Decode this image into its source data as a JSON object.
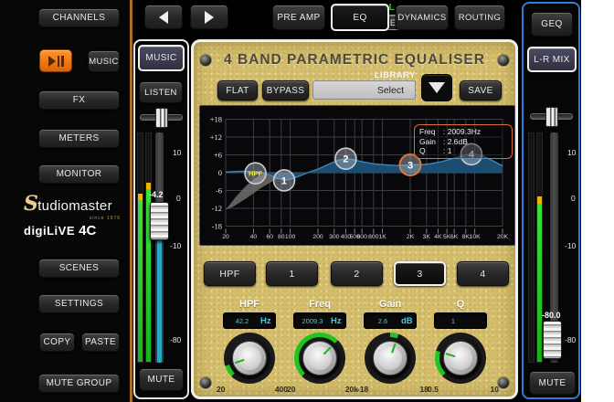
{
  "colors": {
    "accent_orange": "#f07818",
    "sidebar_border_orange": "#b56a1e",
    "master_border_blue": "#2b7fd6",
    "panel_gold": "#d4be6e",
    "display_cyan": "#3fd0e0",
    "knob_green": "#22c422",
    "meter_green": "#1fcc1f",
    "meter_yellow": "#f0b400",
    "curve_fill": "#1c5176",
    "curve_stroke": "#3f88b8",
    "selected_ring_orange": "#e07838",
    "mode_green": "#35d435",
    "fader_lower_cyan": "#2aa8c8"
  },
  "sidebar": {
    "buttons": [
      {
        "label": "CHANNELS"
      },
      {
        "label": "FX"
      },
      {
        "label": "METERS"
      },
      {
        "label": "MONITOR"
      },
      {
        "label": "SCENES"
      },
      {
        "label": "SETTINGS"
      },
      {
        "label": "MUTE GROUP"
      }
    ],
    "play_music_label": "MUSIC",
    "copy_label": "COPY",
    "paste_label": "PASTE",
    "logo": {
      "brand_initial": "S",
      "brand_rest": "tudiomaster",
      "tagline": "since 1976",
      "model": "digiLiVE",
      "model_suffix": "4C"
    }
  },
  "topbar": {
    "mode_status": "FULL",
    "mode_label": "MODE",
    "tabs": [
      {
        "label": "PRE AMP",
        "selected": false
      },
      {
        "label": "EQ",
        "selected": true
      },
      {
        "label": "DYNAMICS",
        "selected": false
      },
      {
        "label": "ROUTING",
        "selected": false
      }
    ]
  },
  "channel_strip": {
    "name": "MUSIC",
    "listen_label": "LISTEN",
    "fader_value": "-4.2",
    "scale": [
      "10",
      "0",
      "-10",
      "-80"
    ],
    "mute_label": "MUTE"
  },
  "master_strip": {
    "geq_label": "GEQ",
    "name": "L-R MIX",
    "fader_value": "-80.0",
    "scale": [
      "10",
      "0",
      "-10",
      "-80"
    ],
    "mute_label": "MUTE"
  },
  "eq_panel": {
    "title": "4 BAND PARAMETRIC EQUALISER",
    "flat_label": "FLAT",
    "bypass_label": "BYPASS",
    "library_label": "LIBRARY",
    "library_value": "Select",
    "save_label": "SAVE",
    "info": [
      {
        "label": "Freq",
        "value": ": 2009.3Hz"
      },
      {
        "label": "Gain",
        "value": ": 2.6dB"
      },
      {
        "label": "Q",
        "value": ": 1"
      }
    ],
    "band_buttons": [
      {
        "label": "HPF",
        "selected": false
      },
      {
        "label": "1",
        "selected": false
      },
      {
        "label": "2",
        "selected": false
      },
      {
        "label": "3",
        "selected": true
      },
      {
        "label": "4",
        "selected": false
      }
    ],
    "knobs": [
      {
        "label": "HPF",
        "value": "42.2",
        "unit": "Hz",
        "min_label": "20",
        "max_label": "400",
        "fraction": 0.1,
        "bipolar": false
      },
      {
        "label": "Freq",
        "value": "2009.3",
        "unit": "Hz",
        "min_label": "20",
        "max_label": "20k",
        "fraction": 0.667,
        "bipolar": false
      },
      {
        "label": "Gain",
        "value": "2.6",
        "unit": "dB",
        "min_label": "-18",
        "max_label": "18",
        "fraction": 0.572,
        "bipolar": true
      },
      {
        "label": "Q",
        "value": "1",
        "unit": "",
        "min_label": "0.5",
        "max_label": "10",
        "fraction": 0.23,
        "bipolar": false
      }
    ]
  },
  "chart_data": {
    "type": "line",
    "title": "4 BAND PARAMETRIC EQUALISER",
    "x_scale": "log",
    "xlim": [
      20,
      20000
    ],
    "ylim": [
      -21,
      21
    ],
    "y_unit": "dB",
    "x_unit": "Hz",
    "grid": true,
    "x_ticks": [
      {
        "f": 20,
        "label": "20"
      },
      {
        "f": 40,
        "label": "40"
      },
      {
        "f": 60,
        "label": "60"
      },
      {
        "f": 80,
        "label": "80"
      },
      {
        "f": 100,
        "label": "100"
      },
      {
        "f": 200,
        "label": "200"
      },
      {
        "f": 300,
        "label": "300"
      },
      {
        "f": 400,
        "label": "400"
      },
      {
        "f": 500,
        "label": "500"
      },
      {
        "f": 600,
        "label": "600"
      },
      {
        "f": 800,
        "label": "800"
      },
      {
        "f": 1000,
        "label": "1K"
      },
      {
        "f": 2000,
        "label": "2K"
      },
      {
        "f": 3000,
        "label": "3K"
      },
      {
        "f": 4000,
        "label": "4K"
      },
      {
        "f": 5000,
        "label": "5K"
      },
      {
        "f": 6000,
        "label": "6K"
      },
      {
        "f": 8000,
        "label": "8K"
      },
      {
        "f": 10000,
        "label": "10K"
      },
      {
        "f": 20000,
        "label": "20K"
      }
    ],
    "y_ticks": [
      {
        "v": 18,
        "label": "+18"
      },
      {
        "v": 12,
        "label": "+12"
      },
      {
        "v": 6,
        "label": "+6"
      },
      {
        "v": 0,
        "label": "0"
      },
      {
        "v": -6,
        "label": "-6"
      },
      {
        "v": -12,
        "label": "-12"
      },
      {
        "v": -18,
        "label": "-18"
      }
    ],
    "response_curve": [
      [
        20,
        0.2
      ],
      [
        30,
        0.5
      ],
      [
        45,
        0.2
      ],
      [
        60,
        -0.8
      ],
      [
        75,
        -2.0
      ],
      [
        88,
        -2.6
      ],
      [
        105,
        -2.0
      ],
      [
        130,
        -1.0
      ],
      [
        160,
        0.2
      ],
      [
        200,
        1.2
      ],
      [
        260,
        2.8
      ],
      [
        330,
        4.2
      ],
      [
        400,
        4.7
      ],
      [
        480,
        4.4
      ],
      [
        600,
        3.7
      ],
      [
        800,
        3.0
      ],
      [
        1000,
        2.7
      ],
      [
        1400,
        2.4
      ],
      [
        2000,
        2.6
      ],
      [
        2600,
        2.7
      ],
      [
        3300,
        3.0
      ],
      [
        4500,
        3.8
      ],
      [
        6000,
        4.9
      ],
      [
        8000,
        6.0
      ],
      [
        9500,
        6.3
      ],
      [
        12000,
        5.8
      ],
      [
        15000,
        4.3
      ],
      [
        20000,
        2.3
      ]
    ],
    "hpf_shade_polygon": [
      [
        20,
        -12.5
      ],
      [
        26,
        -8
      ],
      [
        33,
        -4.5
      ],
      [
        42,
        -1.8
      ],
      [
        52,
        -0.4
      ],
      [
        62,
        0.1
      ],
      [
        100,
        -0.3
      ],
      [
        70,
        -2.2
      ],
      [
        48,
        -5.2
      ],
      [
        34,
        -8.5
      ],
      [
        24,
        -11.5
      ]
    ],
    "bands": [
      {
        "id": "HPF",
        "freq": 42,
        "gain": -0.2,
        "selected": false,
        "label_color": "#f2ee3a"
      },
      {
        "id": "1",
        "freq": 86,
        "gain": -2.6,
        "selected": false,
        "label_color": "#ffffff"
      },
      {
        "id": "2",
        "freq": 400,
        "gain": 4.7,
        "selected": false,
        "label_color": "#ffffff"
      },
      {
        "id": "3",
        "freq": 2000,
        "gain": 2.6,
        "selected": true,
        "label_color": "#ffffff"
      },
      {
        "id": "4",
        "freq": 9200,
        "gain": 6.2,
        "selected": false,
        "label_color": "#ffffff"
      }
    ],
    "selected_band_readout": {
      "freq_hz": 2009.3,
      "gain_db": 2.6,
      "q": 1
    }
  }
}
